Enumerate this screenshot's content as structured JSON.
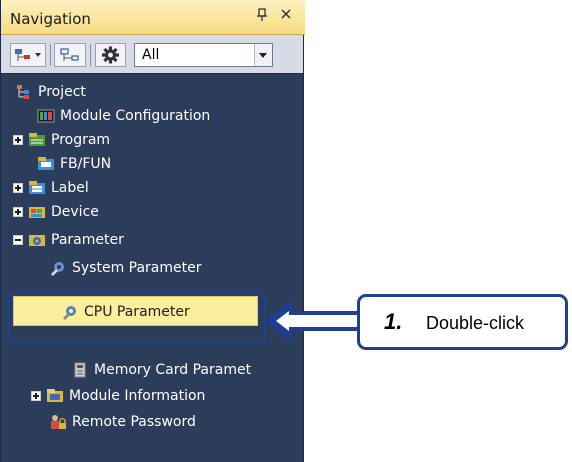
{
  "panel": {
    "title": "Navigation",
    "pin_glyph": "1",
    "close_glyph": "×"
  },
  "toolbar": {
    "filter_value": "All"
  },
  "tree": {
    "project": "Project",
    "module_configuration": "Module Configuration",
    "program": "Program",
    "fb_fun": "FB/FUN",
    "label": "Label",
    "device": "Device",
    "parameter": "Parameter",
    "system_parameter": "System Parameter",
    "cpu_parameter": "CPU Parameter",
    "memory_card_parameter": "Memory Card Paramet",
    "module_information": "Module Information",
    "remote_password": "Remote Password"
  },
  "callout": {
    "step": "1.",
    "text": "Double-click"
  },
  "colors": {
    "panel_bg": "#2b3d5b",
    "header_bg": "#f7dc84",
    "highlight": "#fbee9c",
    "accent_blue": "#1e3f93"
  }
}
